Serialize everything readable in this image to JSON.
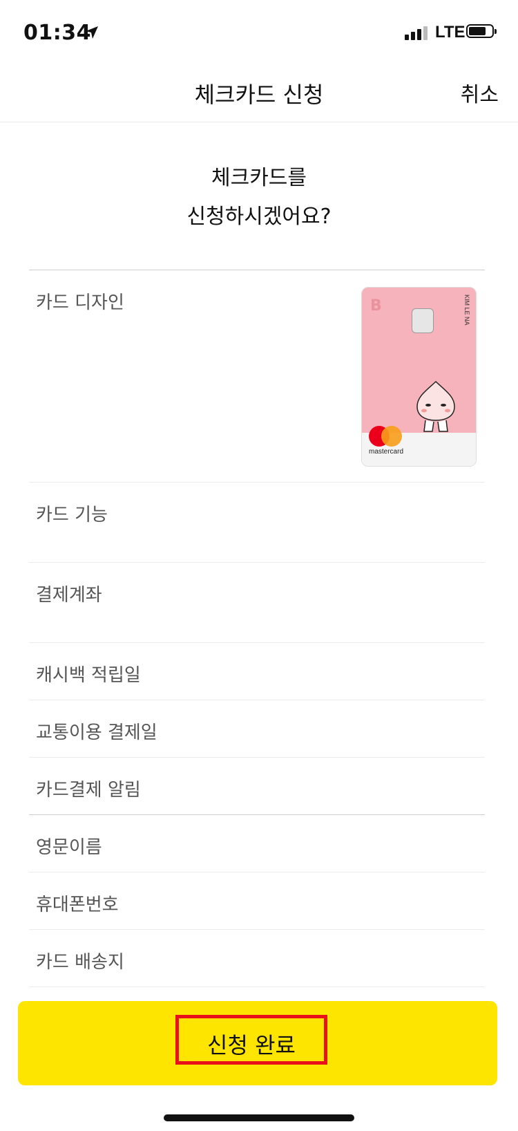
{
  "status": {
    "time": "01:34",
    "network": "LTE"
  },
  "nav": {
    "title": "체크카드 신청",
    "cancel": "취소"
  },
  "heading": {
    "line1": "체크카드를",
    "line2": "신청하시겠어요?"
  },
  "card": {
    "holder": "KIM LE NA",
    "network": "mastercard"
  },
  "rows": [
    {
      "label": "카드 디자인"
    },
    {
      "label": "카드 기능",
      "value": "",
      "value2": ""
    },
    {
      "label": "결제계좌",
      "value": "",
      "value2": ""
    },
    {
      "label": "캐시백 적립일",
      "value": ""
    },
    {
      "label": "교통이용 결제일",
      "value": ""
    },
    {
      "label": "카드결제 알림",
      "value": ""
    },
    {
      "label": "영문이름",
      "value": ""
    },
    {
      "label": "휴대폰번호",
      "value": ""
    },
    {
      "label": "카드 배송지",
      "value": ""
    }
  ],
  "cta": {
    "label": "신청 완료"
  },
  "colors": {
    "accent": "#fee500",
    "highlight": "#e8101a",
    "card": "#f6b3bb"
  }
}
